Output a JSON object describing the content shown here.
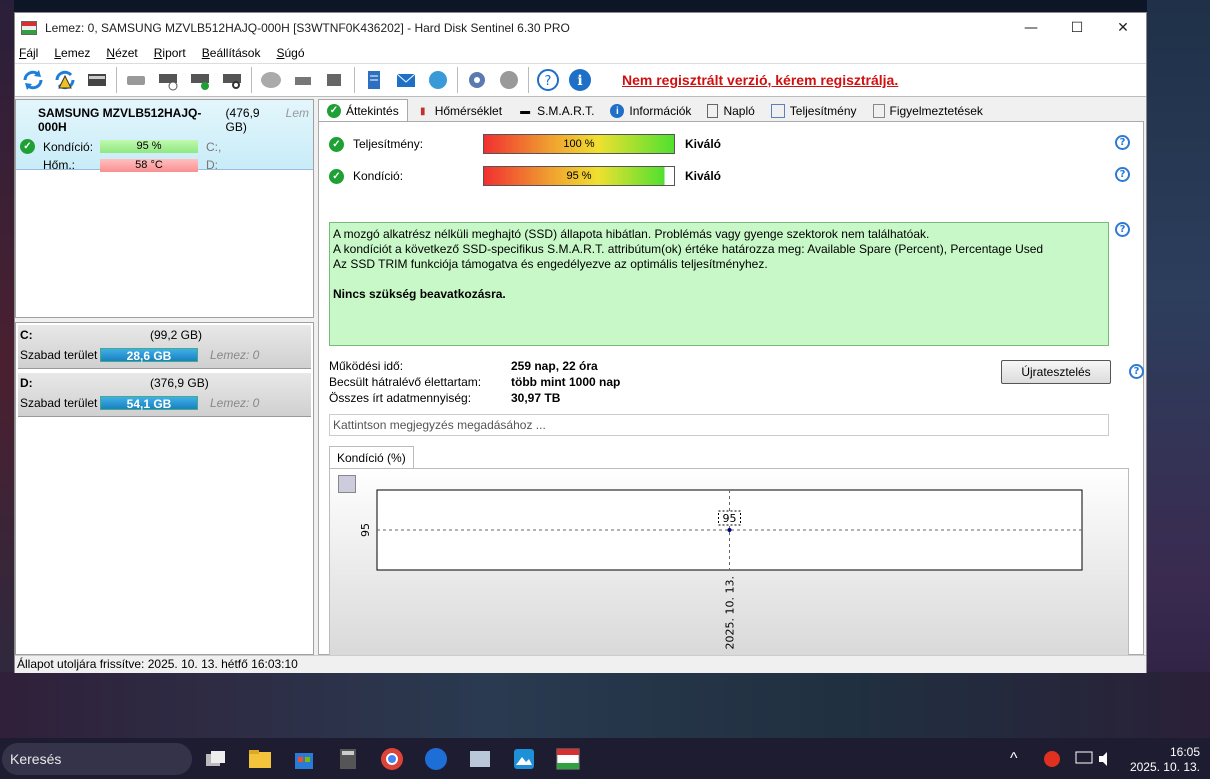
{
  "window": {
    "title": "Lemez: 0, SAMSUNG MZVLB512HAJQ-000H [S3WTNF0K436202]  -  Hard Disk Sentinel 6.30 PRO",
    "minimize": "—",
    "maximize": "☐",
    "close": "✕"
  },
  "menu": [
    "Fájl",
    "Lemez",
    "Nézet",
    "Riport",
    "Beállítások",
    "Súgó"
  ],
  "toolbar": {
    "icons": [
      "refresh-icon",
      "refresh-warning-icon",
      "disk-icon",
      "disk-gray-icon",
      "disk-clock-icon",
      "disk-check-icon",
      "disk-search-icon",
      "hdd-icon",
      "tools-icon",
      "disk-export-icon",
      "report-icon",
      "mail-icon",
      "globe-icon",
      "settings-icon",
      "sound-icon",
      "help-icon",
      "info-icon"
    ],
    "registration_warning": "Nem regisztrált verzió, kérem regisztrálja."
  },
  "disk": {
    "name": "SAMSUNG MZVLB512HAJQ-000H",
    "size": "(476,9 GB)",
    "extra": "Lem",
    "condition_label": "Kondíció:",
    "condition_value": "95 %",
    "condition_drive": "C:,",
    "temp_label": "Hőm.:",
    "temp_value": "58 °C",
    "temp_drive": "D:"
  },
  "volumes": [
    {
      "letter": "C:",
      "size": "(99,2 GB)",
      "free_label": "Szabad terület",
      "free": "28,6 GB",
      "disk": "Lemez: 0"
    },
    {
      "letter": "D:",
      "size": "(376,9 GB)",
      "free_label": "Szabad terület",
      "free": "54,1 GB",
      "disk": "Lemez: 0"
    }
  ],
  "tabs": [
    "Áttekintés",
    "Hőmérséklet",
    "S.M.A.R.T.",
    "Információk",
    "Napló",
    "Teljesítmény",
    "Figyelmeztetések"
  ],
  "overview": {
    "performance_label": "Teljesítmény:",
    "performance_value": "100 %",
    "performance_level": 1.0,
    "performance_rating": "Kiváló",
    "condition_label": "Kondíció:",
    "condition_value": "95 %",
    "condition_level": 0.95,
    "condition_rating": "Kiváló",
    "message_lines": [
      "A mozgó alkatrész nélküli meghajtó (SSD) állapota hibátlan. Problémás vagy gyenge szektorok nem találhatóak.",
      "A kondíciót a következő SSD-specifikus S.M.A.R.T. attribútum(ok) értéke határozza meg:  Available Spare (Percent), Percentage Used",
      "Az SSD TRIM funkciója támogatva és engedélyezve az optimális teljesítményhez."
    ],
    "message_bold": "Nincs szükség beavatkozásra.",
    "uptime_label": "Működési idő:",
    "uptime_value": "259 nap, 22 óra",
    "lifetime_label": "Becsült hátralévő élettartam:",
    "lifetime_value": "több mint 1000 nap",
    "written_label": "Összes írt adatmennyiség:",
    "written_value": "30,97 TB",
    "retest_button": "Újratesztelés",
    "note_placeholder": "Kattintson megjegyzés megadásához ..."
  },
  "chart_data": {
    "type": "line",
    "title": "Kondíció  (%)",
    "x": [
      "2025. 10. 13."
    ],
    "series": [
      {
        "values": [
          95
        ]
      }
    ],
    "yticks": [
      "95"
    ],
    "data_labels": [
      "95"
    ]
  },
  "status": "Állapot utoljára frissítve: 2025. 10. 13. hétfő 16:03:10",
  "taskbar": {
    "search": "Keresés",
    "time": "16:05",
    "date": "2025. 10. 13."
  }
}
